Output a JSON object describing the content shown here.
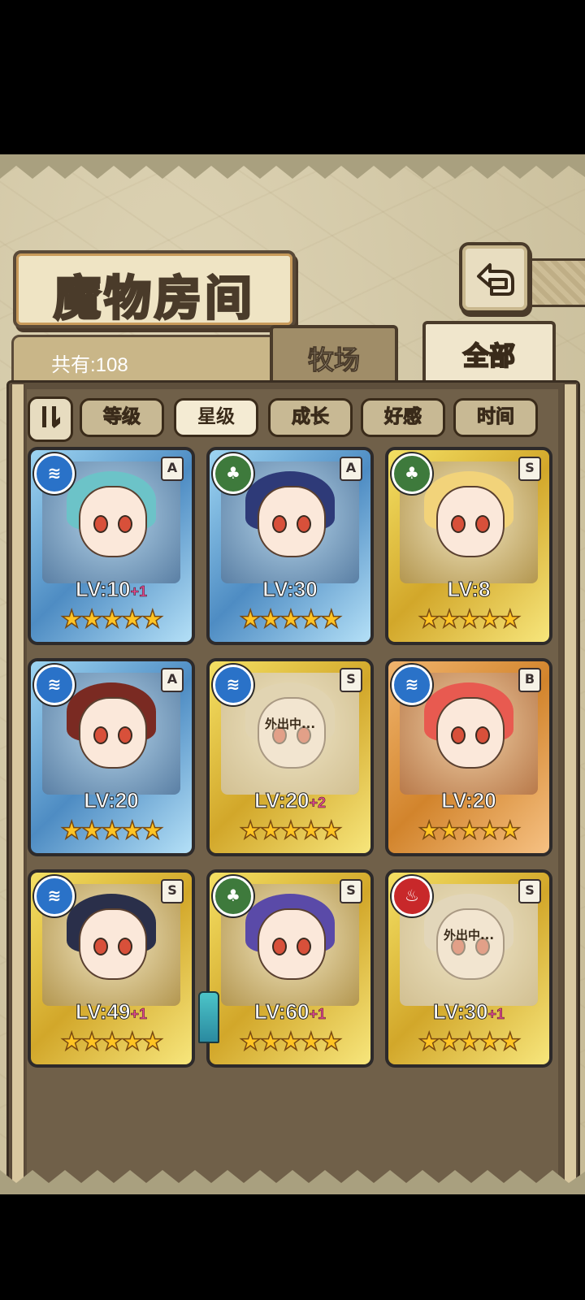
{
  "title": "魔物房间",
  "count_label": "共有:108",
  "tabs": {
    "farm": "牧场",
    "all": "全部"
  },
  "sort": {
    "toggle_glyph": "I⁄",
    "options": [
      "等级",
      "星级",
      "成长",
      "好感",
      "时间"
    ],
    "active": "星级"
  },
  "away_text": "外出中...",
  "colors": {
    "water": "#2a72c8",
    "nature": "#3e7a3c",
    "fire": "#c8282a",
    "plus": "#e24c8e"
  },
  "monsters": [
    {
      "element": "water",
      "rank": "A",
      "lv": "LV:10",
      "plus": "+1",
      "stars": "★★★★★",
      "frame": "blue",
      "away": false
    },
    {
      "element": "nature",
      "rank": "A",
      "lv": "LV:30",
      "plus": "",
      "stars": "★★★★★",
      "frame": "blue",
      "away": false
    },
    {
      "element": "nature",
      "rank": "S",
      "lv": "LV:8",
      "plus": "",
      "stars": "★★★★★",
      "frame": "gold",
      "away": false
    },
    {
      "element": "water",
      "rank": "A",
      "lv": "LV:20",
      "plus": "",
      "stars": "★★★★★",
      "frame": "blue",
      "away": false
    },
    {
      "element": "water",
      "rank": "S",
      "lv": "LV:20",
      "plus": "+2",
      "stars": "★★★★★",
      "frame": "gold",
      "away": true
    },
    {
      "element": "water",
      "rank": "B",
      "lv": "LV:20",
      "plus": "",
      "stars": "★★★★★",
      "frame": "orange",
      "away": false
    },
    {
      "element": "water",
      "rank": "S",
      "lv": "LV:49",
      "plus": "+1",
      "stars": "★★★★★",
      "frame": "gold",
      "away": false
    },
    {
      "element": "nature",
      "rank": "S",
      "lv": "LV:60",
      "plus": "+1",
      "stars": "★★★★★",
      "frame": "gold",
      "away": false
    },
    {
      "element": "fire",
      "rank": "S",
      "lv": "LV:30",
      "plus": "+1",
      "stars": "★★★★★",
      "frame": "gold",
      "away": true
    }
  ]
}
